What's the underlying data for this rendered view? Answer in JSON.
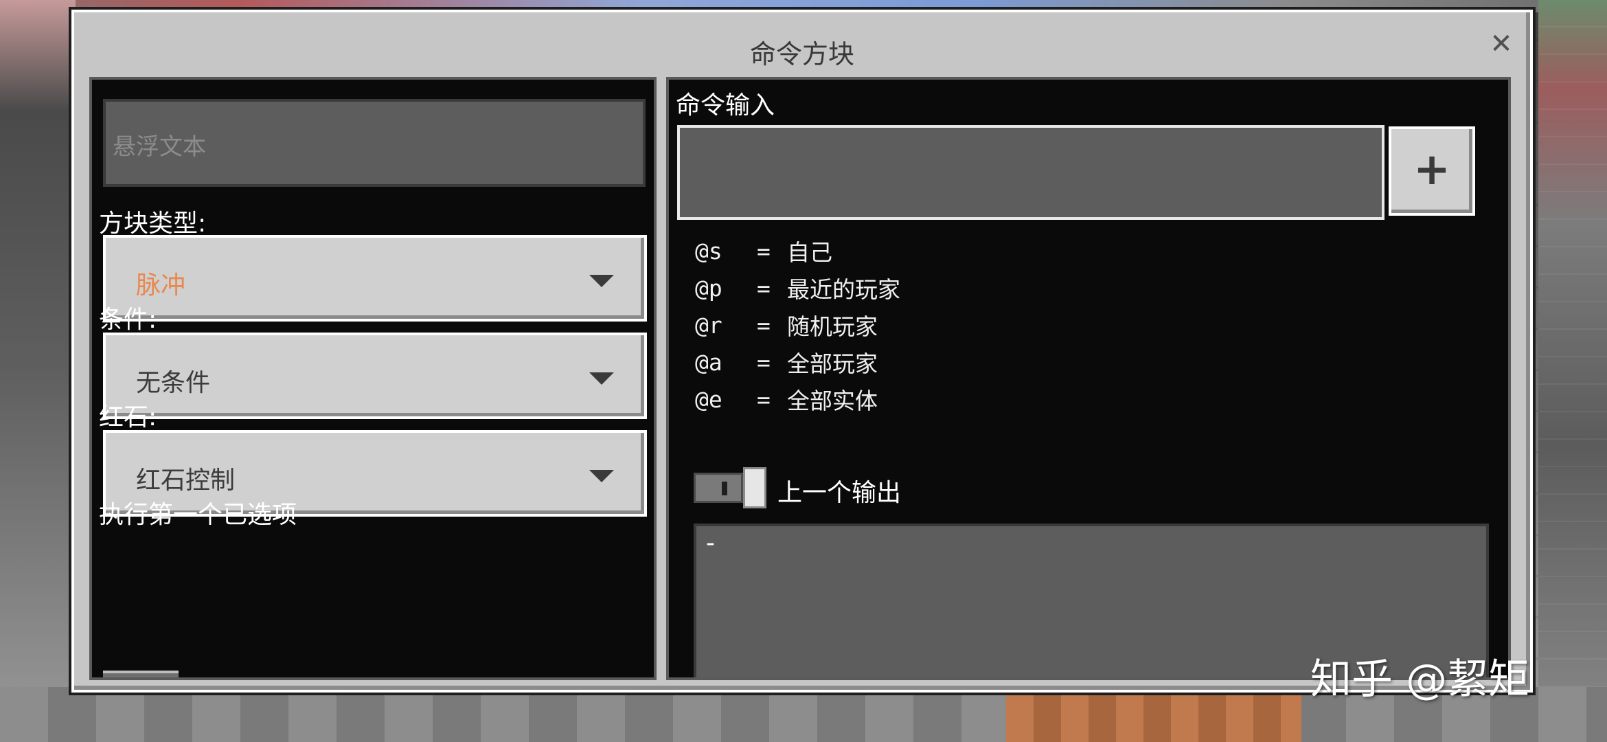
{
  "dialog": {
    "title": "命令方块",
    "close_glyph": "✕"
  },
  "left_panel": {
    "hover_text_placeholder": "悬浮文本",
    "block_type": {
      "label": "方块类型:",
      "value": "脉冲"
    },
    "condition": {
      "label": "条件:",
      "value": "无条件"
    },
    "redstone": {
      "label": "红石:",
      "value": "红石控制"
    },
    "execute_first_label": "执行第一个已选项"
  },
  "right_panel": {
    "command_input_label": "命令输入",
    "add_button_glyph": "+",
    "selectors": [
      {
        "code": "@s",
        "eq": "=",
        "desc": "自己"
      },
      {
        "code": "@p",
        "eq": "=",
        "desc": "最近的玩家"
      },
      {
        "code": "@r",
        "eq": "=",
        "desc": "随机玩家"
      },
      {
        "code": "@a",
        "eq": "=",
        "desc": "全部玩家"
      },
      {
        "code": "@e",
        "eq": "=",
        "desc": "全部实体"
      }
    ],
    "previous_output_label": "上一个输出",
    "output_text": "-"
  },
  "watermark": "知乎 @絜矩",
  "colors": {
    "accent_value": "#e8884f",
    "panel_bg": "#0a0a0a",
    "dialog_bg": "#c6c6c6"
  }
}
